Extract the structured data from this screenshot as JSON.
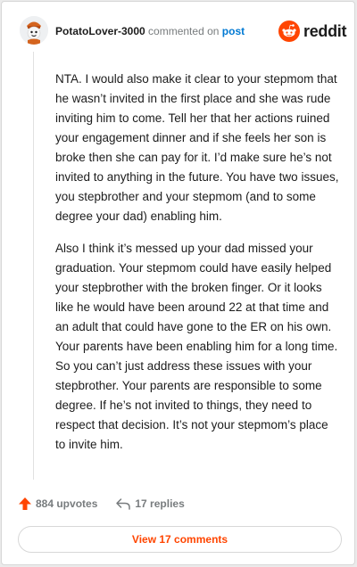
{
  "header": {
    "username": "PotatoLover-3000",
    "action_text": "commented on",
    "post_link": "post",
    "logo_text": "reddit"
  },
  "comment": {
    "paragraphs": [
      "NTA. I would also make it clear to your stepmom that he wasn’t invited in the first place and she was rude inviting him to come. Tell her that her actions ruined your engagement dinner and if she feels her son is broke then she can pay for it. I’d make sure he’s not invited to anything in the future. You have two issues, you stepbrother and your stepmom (and to some degree your dad) enabling him.",
      "Also I think it’s messed up your dad missed your graduation. Your stepmom could have easily helped your stepbrother with the broken finger. Or it looks like he would have been around 22 at that time and an adult that could have gone to the ER on his own. Your parents have been enabling him for a long time. So you can’t just address these issues with your stepbrother. Your parents are responsible to some degree. If he’s not invited to things, they need to respect that decision. It’s not your stepmom’s place to invite him."
    ]
  },
  "footer": {
    "upvotes": "884 upvotes",
    "replies": "17 replies",
    "view_comments": "View 17 comments"
  },
  "colors": {
    "accent": "#ff4500",
    "link": "#0079d3"
  },
  "icons": [
    "avatar-icon",
    "reddit-logo-icon",
    "upvote-arrow-icon",
    "reply-arrow-icon"
  ]
}
